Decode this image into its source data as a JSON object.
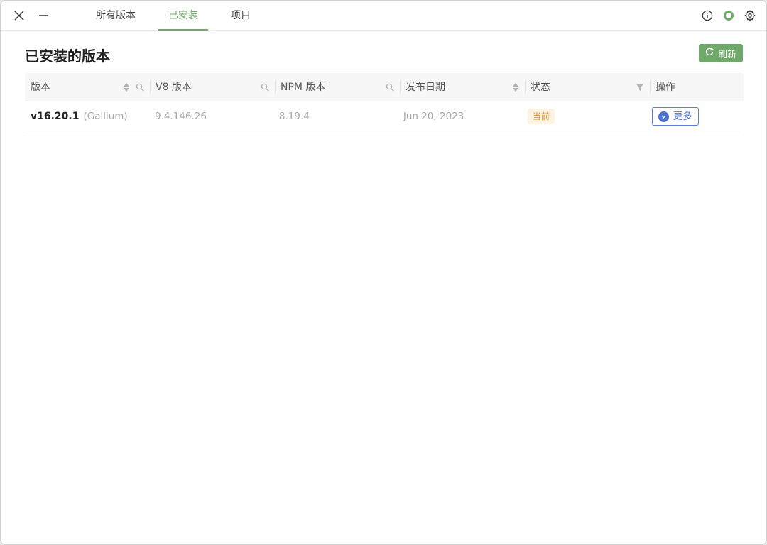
{
  "titlebar": {
    "tabs": [
      {
        "label": "所有版本",
        "active": false
      },
      {
        "label": "已安装",
        "active": true
      },
      {
        "label": "项目",
        "active": false
      }
    ],
    "icons": [
      "close-icon",
      "minimize-icon",
      "info-icon",
      "status-ring-icon",
      "gear-icon"
    ]
  },
  "page": {
    "title": "已安装的版本",
    "refresh_label": "刷新"
  },
  "table": {
    "columns": [
      {
        "label": "版本"
      },
      {
        "label": "V8 版本"
      },
      {
        "label": "NPM 版本"
      },
      {
        "label": "发布日期"
      },
      {
        "label": "状态"
      },
      {
        "label": "操作"
      }
    ],
    "rows": [
      {
        "version": "v16.20.1",
        "codename": "(Gallium)",
        "v8": "9.4.146.26",
        "npm": "8.19.4",
        "date": "Jun 20, 2023",
        "status": "当前",
        "action": "更多"
      }
    ]
  },
  "colors": {
    "accent": "#6fa96a",
    "link": "#4c72d6",
    "badge_bg": "#fdf3e2",
    "badge_text": "#e0912e"
  }
}
